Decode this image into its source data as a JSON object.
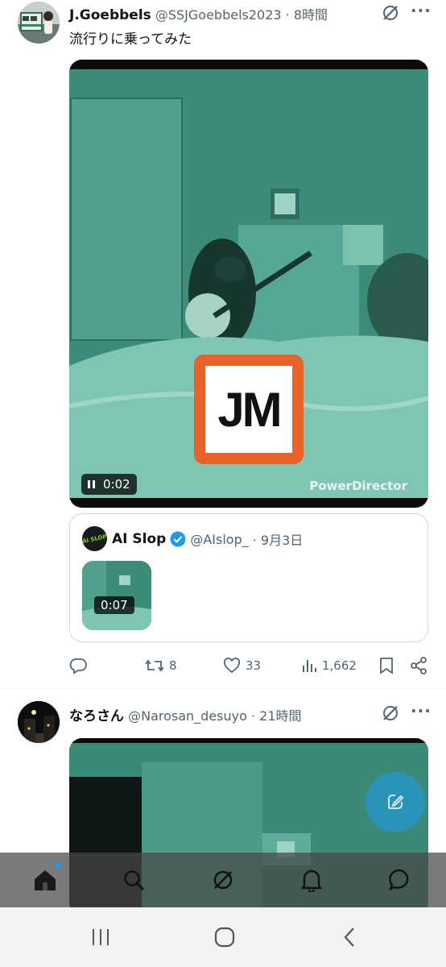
{
  "tweet1": {
    "name": "J.Goebbels",
    "handle": "@SSJGoebbels2023",
    "time": "· 8時間",
    "text": "流行りに乗ってみた",
    "video": {
      "time": "0:02",
      "watermark": "PowerDirector",
      "logo_text": "JM"
    },
    "quote": {
      "name": "AI Slop",
      "handle": "@AIslop_",
      "time": "· 9月3日",
      "video_time": "0:07",
      "avatar_text": "AI SLOP"
    },
    "actions": {
      "retweets": "8",
      "likes": "33",
      "views": "1,662"
    }
  },
  "tweet2": {
    "name": "なろさん",
    "handle": "@Narosan_desuyo",
    "time": "· 21時間"
  },
  "colors": {
    "accent": "#1d9bf0",
    "logo_orange": "#e8632a",
    "video_green": "#3f8f7e"
  }
}
